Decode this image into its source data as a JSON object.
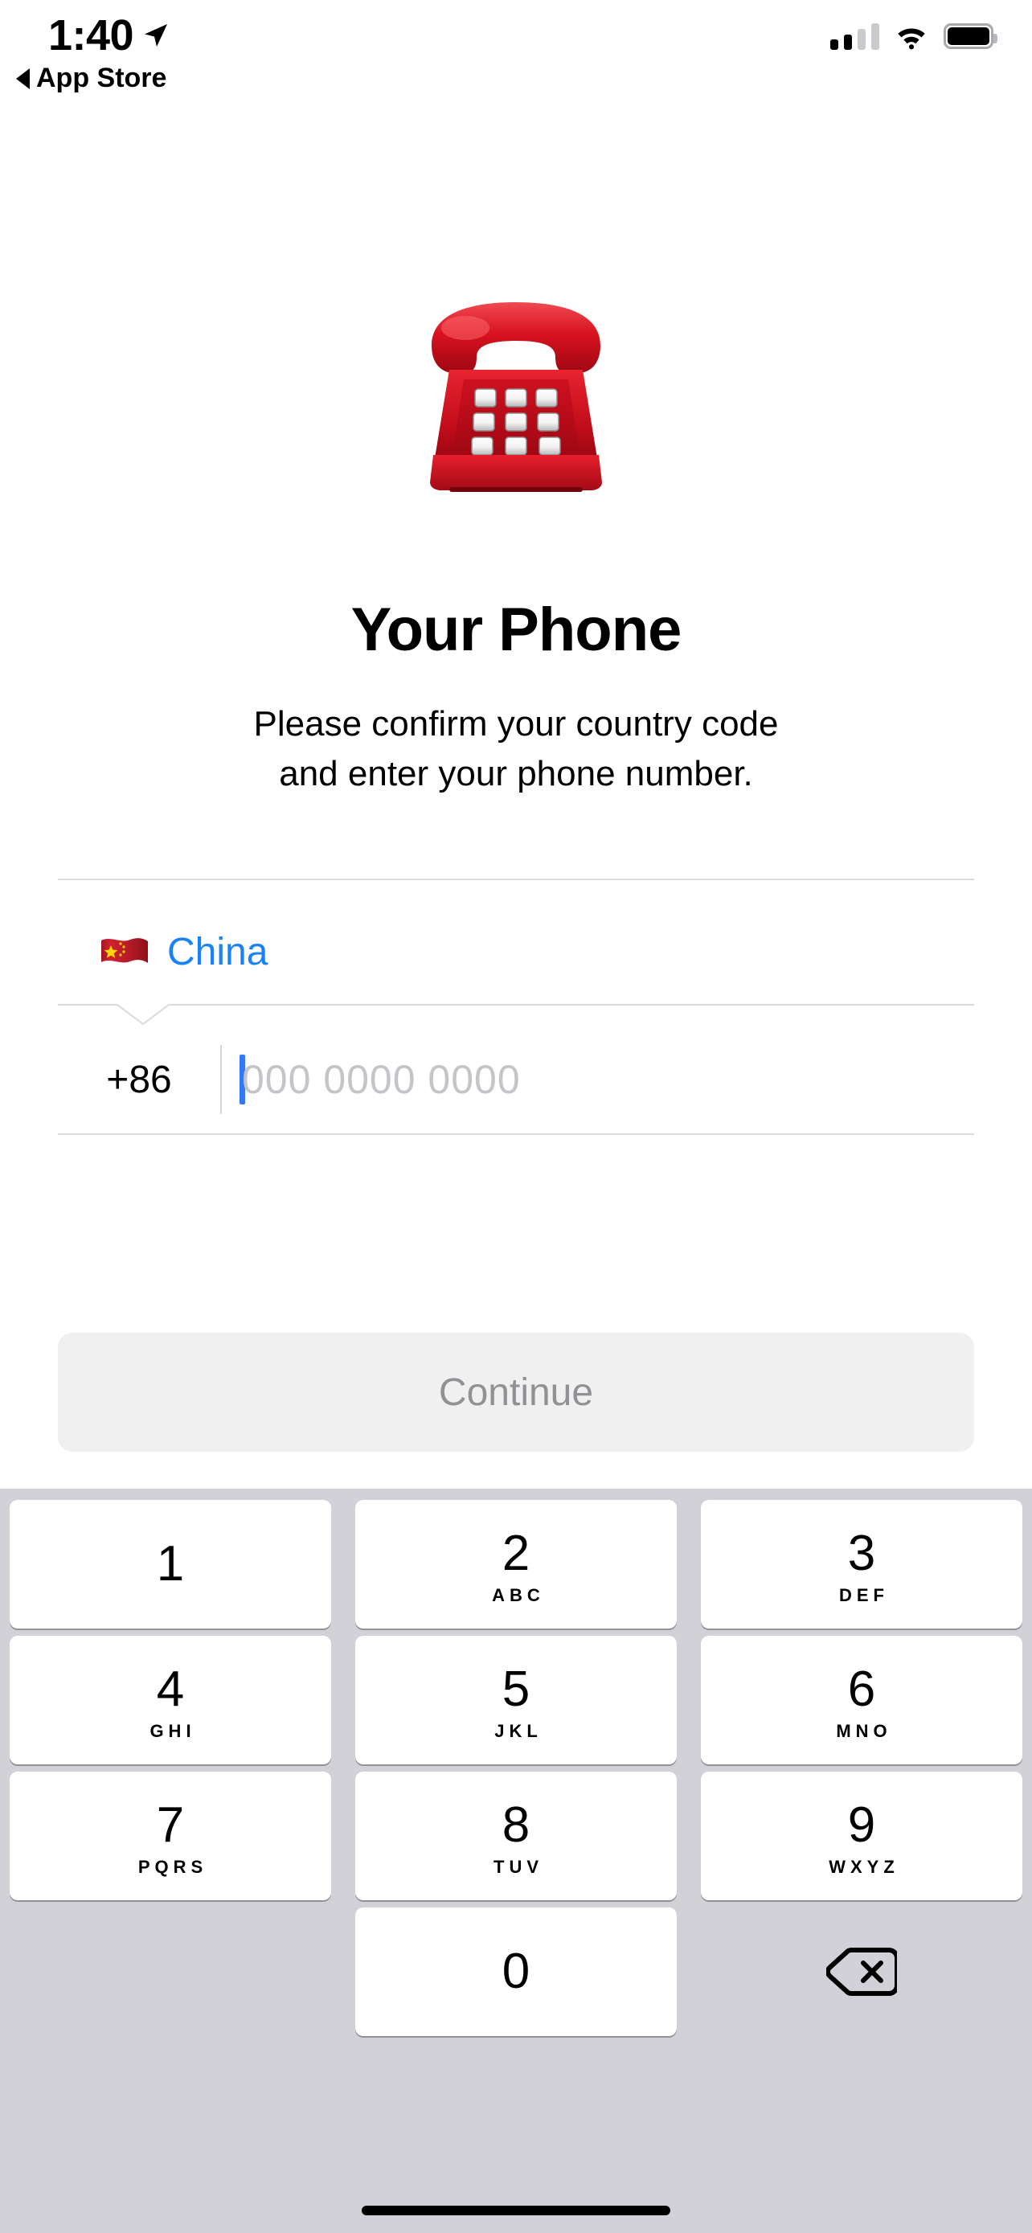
{
  "status_bar": {
    "time": "1:40",
    "location_icon": "location-arrow-icon",
    "back_label": "App Store",
    "back_icon": "back-triangle-icon",
    "cellular_icon": "cellular-signal-icon",
    "cellular_bars_filled": 2,
    "cellular_bars_total": 4,
    "wifi_icon": "wifi-icon",
    "battery_icon": "battery-icon",
    "battery_level_percent": 100
  },
  "hero": {
    "emoji_name": "telephone-emoji",
    "emoji_char": "☎️",
    "title": "Your Phone",
    "subtitle_line1": "Please confirm your country code",
    "subtitle_line2": "and enter your phone number."
  },
  "form": {
    "country": {
      "flag_name": "china-flag-emoji",
      "flag_char": "🇨🇳",
      "name": "China",
      "color": "#1a82f7"
    },
    "dial_code": "+86",
    "phone_number_value": "",
    "phone_number_placeholder": "000 0000 0000",
    "caret_color": "#3478f6"
  },
  "actions": {
    "continue_label": "Continue",
    "continue_enabled": false,
    "continue_text_color": "#919195",
    "continue_bg_color": "#f0f0f1"
  },
  "keyboard": {
    "background_color": "#d1d1d7",
    "delete_icon": "backspace-delete-icon",
    "rows": [
      [
        {
          "digit": "1",
          "letters": ""
        },
        {
          "digit": "2",
          "letters": "ABC"
        },
        {
          "digit": "3",
          "letters": "DEF"
        }
      ],
      [
        {
          "digit": "4",
          "letters": "GHI"
        },
        {
          "digit": "5",
          "letters": "JKL"
        },
        {
          "digit": "6",
          "letters": "MNO"
        }
      ],
      [
        {
          "digit": "7",
          "letters": "PQRS"
        },
        {
          "digit": "8",
          "letters": "TUV"
        },
        {
          "digit": "9",
          "letters": "WXYZ"
        }
      ],
      [
        {
          "digit": "0",
          "letters": ""
        }
      ]
    ]
  }
}
